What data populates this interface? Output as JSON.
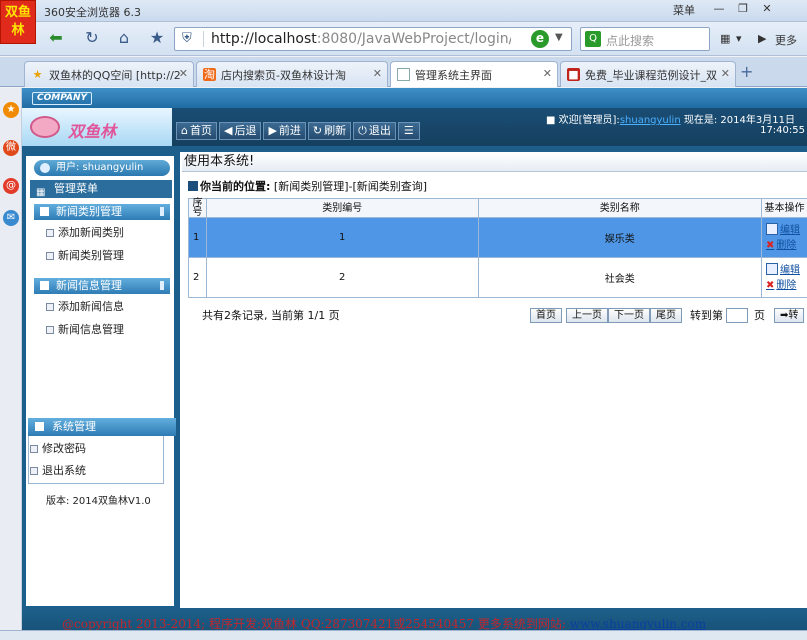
{
  "browser": {
    "logo_line1": "双鱼",
    "logo_line2": "林",
    "title": "360安全浏览器 6.3",
    "menu_label": "菜单",
    "url_main": "http://localhost",
    "url_rest": ":8080/JavaWebProject/login/lo",
    "search_placeholder": "点此搜索",
    "more_label": "更多",
    "tabs": [
      {
        "label": "双鱼林的QQ空间 [http://2",
        "icon": "star-icon"
      },
      {
        "label": "店内搜索页-双鱼林设计淘",
        "icon": "shop-icon"
      },
      {
        "label": "管理系统主界面",
        "icon": "page-icon"
      },
      {
        "label": "免费_毕业课程范例设计_双",
        "icon": "book-icon"
      }
    ],
    "new_tab": "+"
  },
  "header": {
    "company_tag": "COMPANY",
    "logo_text": "双鱼林",
    "buttons": [
      {
        "label": "首页",
        "icon": "home-icon",
        "glyph": "⌂"
      },
      {
        "label": "后退",
        "icon": "back-icon",
        "glyph": "◀"
      },
      {
        "label": "前进",
        "icon": "forward-icon",
        "glyph": "▶"
      },
      {
        "label": "刷新",
        "icon": "refresh-icon",
        "glyph": "↻"
      },
      {
        "label": "退出",
        "icon": "power-icon",
        "glyph": "⏻"
      }
    ],
    "welcome_prefix": "■ 欢迎[管理员]:",
    "username": "shuangyulin",
    "now_label": "现在是: 2014年3月11日",
    "time": "17:40:55"
  },
  "sidebar": {
    "user_label": "用户: shuangyulin",
    "menu_title": "管理菜单",
    "groups": [
      {
        "title": "新闻类别管理",
        "items": [
          "添加新闻类别",
          "新闻类别管理"
        ]
      },
      {
        "title": "新闻信息管理",
        "items": [
          "添加新闻信息",
          "新闻信息管理"
        ]
      }
    ],
    "system_title": "系统管理",
    "system_items": [
      "修改密码",
      "退出系统"
    ],
    "version": "版本: 2014双鱼林V1.0"
  },
  "content": {
    "title": "使用本系统!",
    "location_label": "你当前的位置:",
    "location_path": "[新闻类别管理]-[新闻类别查询]",
    "columns": [
      "序号",
      "类别编号",
      "类别名称",
      "基本操作"
    ],
    "rows": [
      {
        "seq": "1",
        "code": "1",
        "name": "娱乐类",
        "edit": "编辑",
        "delete": "删除"
      },
      {
        "seq": "2",
        "code": "2",
        "name": "社会类",
        "edit": "编辑",
        "delete": "删除"
      }
    ],
    "pager": {
      "summary": "共有2条记录, 当前第 1/1 页",
      "first": "首页",
      "prev": "上一页",
      "next": "下一页",
      "last": "尾页",
      "goto_label": "转到第",
      "page_unit": "页",
      "go": "➡转"
    }
  },
  "footer": {
    "copyright": "@copyright 2013-2014;  程序开发:双鱼林  QQ:287307421或254540457  更多系统到网站:",
    "site": "www.shuangyulin.com"
  },
  "colors": {
    "frame_blue": "#1d5f8a",
    "selected_row": "#4f97e6",
    "footer_red": "#c1272d"
  }
}
